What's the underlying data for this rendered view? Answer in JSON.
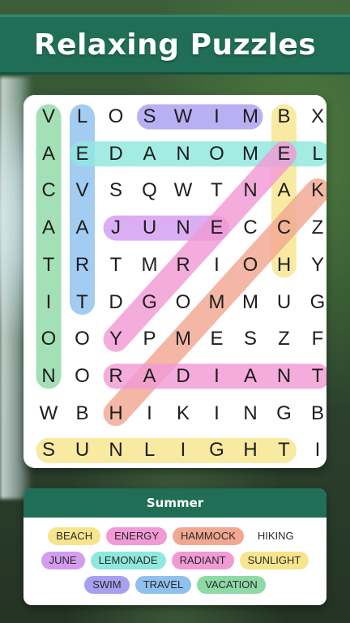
{
  "banner": {
    "title": "Relaxing Puzzles"
  },
  "grid": {
    "rows": [
      [
        "V",
        "L",
        "O",
        "S",
        "W",
        "I",
        "M",
        "B",
        "X"
      ],
      [
        "A",
        "E",
        "D",
        "A",
        "N",
        "O",
        "M",
        "E",
        "L"
      ],
      [
        "C",
        "V",
        "S",
        "Q",
        "W",
        "T",
        "N",
        "A",
        "K"
      ],
      [
        "A",
        "A",
        "J",
        "U",
        "N",
        "E",
        "C",
        "C",
        "Z"
      ],
      [
        "T",
        "R",
        "T",
        "M",
        "R",
        "I",
        "O",
        "H",
        "Y"
      ],
      [
        "I",
        "T",
        "D",
        "G",
        "O",
        "M",
        "M",
        "U",
        "G"
      ],
      [
        "O",
        "O",
        "Y",
        "P",
        "M",
        "E",
        "S",
        "Z",
        "F"
      ],
      [
        "N",
        "O",
        "R",
        "A",
        "D",
        "I",
        "A",
        "N",
        "T"
      ],
      [
        "W",
        "B",
        "H",
        "I",
        "K",
        "I",
        "N",
        "G",
        "B"
      ],
      [
        "S",
        "U",
        "N",
        "L",
        "I",
        "G",
        "H",
        "T",
        "I"
      ]
    ]
  },
  "found_words": [
    {
      "word": "VACATION",
      "color": "#8fd9a6",
      "start": [
        0,
        0
      ],
      "end": [
        7,
        0
      ]
    },
    {
      "word": "TRAVEL",
      "color": "#8fc1ef",
      "start": [
        5,
        1
      ],
      "end": [
        0,
        1
      ]
    },
    {
      "word": "SWIM",
      "color": "#a99ff0",
      "start": [
        0,
        3
      ],
      "end": [
        0,
        6
      ]
    },
    {
      "word": "BEACH",
      "color": "#f6e58c",
      "start": [
        0,
        7
      ],
      "end": [
        4,
        7
      ]
    },
    {
      "word": "LEMONADE",
      "color": "#8fe8de",
      "start": [
        1,
        8
      ],
      "end": [
        1,
        1
      ]
    },
    {
      "word": "JUNE",
      "color": "#d39cf0",
      "start": [
        3,
        2
      ],
      "end": [
        3,
        5
      ]
    },
    {
      "word": "ENERGY",
      "color": "#f19ad6",
      "start": [
        1,
        7
      ],
      "end": [
        6,
        2
      ]
    },
    {
      "word": "HAMMOCK",
      "color": "#f2a792",
      "start": [
        8,
        2
      ],
      "end": [
        2,
        8
      ]
    },
    {
      "word": "RADIANT",
      "color": "#f19ad6",
      "start": [
        7,
        2
      ],
      "end": [
        7,
        8
      ]
    },
    {
      "word": "SUNLIGHT",
      "color": "#f6e58c",
      "start": [
        9,
        0
      ],
      "end": [
        9,
        7
      ]
    }
  ],
  "words_panel": {
    "title": "Summer",
    "rows": [
      [
        {
          "label": "BEACH",
          "color": "#f6e58c"
        },
        {
          "label": "ENERGY",
          "color": "#f19ad6"
        },
        {
          "label": "HAMMOCK",
          "color": "#f2a792"
        },
        {
          "label": "HIKING",
          "color": ""
        }
      ],
      [
        {
          "label": "JUNE",
          "color": "#d39cf0"
        },
        {
          "label": "LEMONADE",
          "color": "#8fe8de"
        },
        {
          "label": "RADIANT",
          "color": "#f19ad6"
        },
        {
          "label": "SUNLIGHT",
          "color": "#f6e58c"
        }
      ],
      [
        {
          "label": "SWIM",
          "color": "#a99ff0"
        },
        {
          "label": "TRAVEL",
          "color": "#8fc1ef"
        },
        {
          "label": "VACATION",
          "color": "#8fd9a6"
        }
      ]
    ]
  }
}
